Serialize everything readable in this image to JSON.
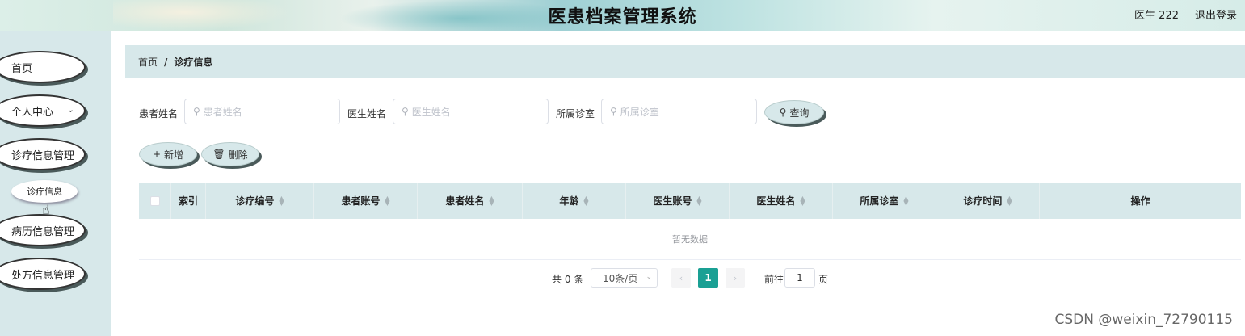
{
  "header": {
    "title": "医患档案管理系统",
    "user": "医生 222",
    "logout": "退出登录"
  },
  "sidebar": {
    "items": [
      {
        "label": "首页"
      },
      {
        "label": "个人中心"
      },
      {
        "label": "诊疗信息管理"
      },
      {
        "label": "病历信息管理"
      },
      {
        "label": "处方信息管理"
      }
    ],
    "subitem": "诊疗信息"
  },
  "breadcrumb": {
    "home": "首页",
    "separator": "/",
    "current": "诊疗信息"
  },
  "search": {
    "patient_label": "患者姓名",
    "patient_placeholder": "患者姓名",
    "doctor_label": "医生姓名",
    "doctor_placeholder": "医生姓名",
    "room_label": "所属诊室",
    "room_placeholder": "所属诊室",
    "query_button": "查询"
  },
  "actions": {
    "add": "新增",
    "delete": "删除"
  },
  "table": {
    "columns": [
      "索引",
      "诊疗编号",
      "患者账号",
      "患者姓名",
      "年龄",
      "医生账号",
      "医生姓名",
      "所属诊室",
      "诊疗时间",
      "操作"
    ],
    "empty_text": "暂无数据"
  },
  "pagination": {
    "total": "共 0 条",
    "page_size": "10条/页",
    "current_page": "1",
    "goto": "前往",
    "goto_value": "1",
    "page_unit": "页"
  },
  "watermark": "CSDN @weixin_72790115",
  "colors": {
    "accent": "#1aa094",
    "panel": "#d7e8ea"
  }
}
